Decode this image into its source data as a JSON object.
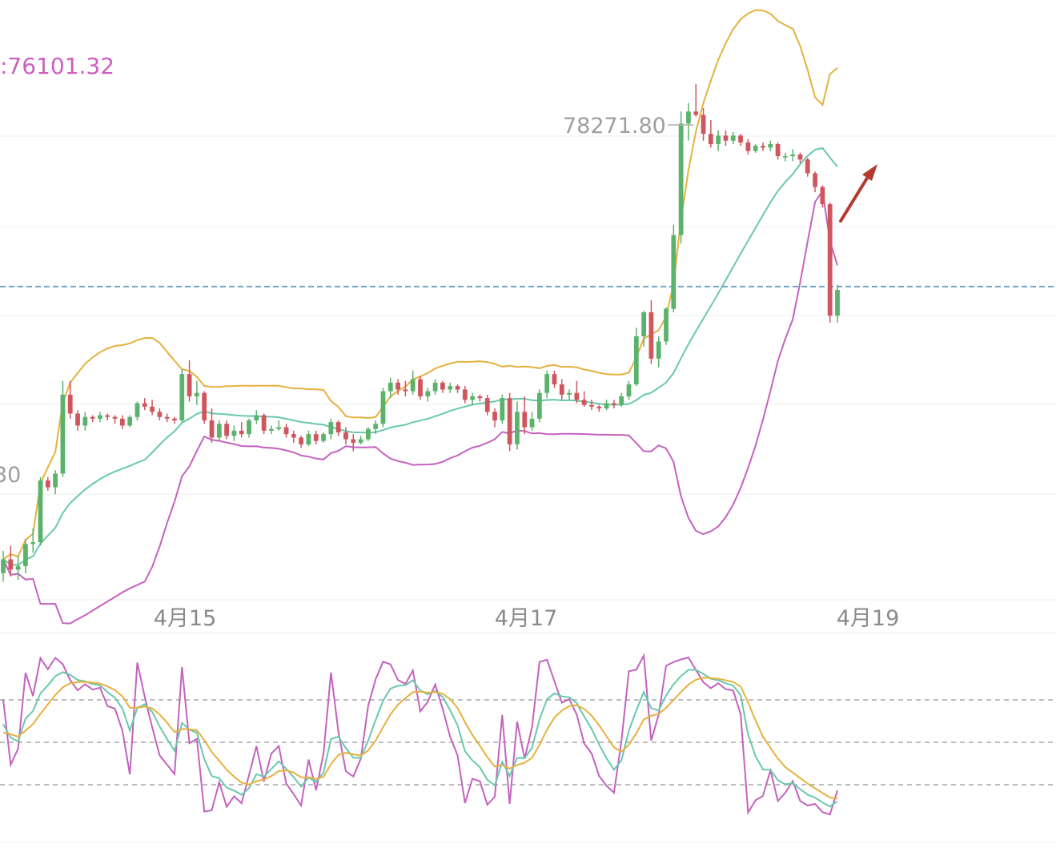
{
  "chart_data": {
    "type": "candlestick",
    "boll_label": ":76101.32",
    "high_marker": "78271.80",
    "low_marker_partial": "30",
    "x_ticks": [
      "4月15",
      "4月17",
      "4月19"
    ],
    "colors": {
      "up": "#5bb26b",
      "down": "#d0565e",
      "boll_upper": "#e6b13e",
      "boll_mid": "#69c8ad",
      "boll_lower": "#c462bf",
      "kdj_k": "#c462bf",
      "kdj_d": "#69c8ad",
      "kdj_j": "#e6b13e",
      "current_price_line": "#6fa5c2",
      "arrow": "#b33a2f",
      "grid": "#eeeeee"
    },
    "candles": [
      [
        75400,
        75530,
        75350,
        75480
      ],
      [
        75480,
        75560,
        75380,
        75420
      ],
      [
        75420,
        75500,
        75360,
        75440
      ],
      [
        75440,
        75600,
        75400,
        75570
      ],
      [
        75570,
        75660,
        75520,
        75580
      ],
      [
        75580,
        75960,
        75560,
        75940
      ],
      [
        75940,
        75960,
        75880,
        75900
      ],
      [
        75900,
        76000,
        75860,
        75980
      ],
      [
        75980,
        76520,
        75960,
        76440
      ],
      [
        76440,
        76520,
        76300,
        76330
      ],
      [
        76330,
        76350,
        76230,
        76260
      ],
      [
        76260,
        76340,
        76230,
        76310
      ],
      [
        76310,
        76320,
        76280,
        76300
      ],
      [
        76300,
        76340,
        76280,
        76320
      ],
      [
        76320,
        76330,
        76290,
        76310
      ],
      [
        76310,
        76320,
        76270,
        76300
      ],
      [
        76300,
        76320,
        76240,
        76260
      ],
      [
        76260,
        76320,
        76250,
        76310
      ],
      [
        76310,
        76400,
        76290,
        76390
      ],
      [
        76390,
        76420,
        76350,
        76370
      ],
      [
        76370,
        76410,
        76320,
        76340
      ],
      [
        76340,
        76360,
        76290,
        76310
      ],
      [
        76310,
        76330,
        76280,
        76300
      ],
      [
        76300,
        76310,
        76270,
        76290
      ],
      [
        76290,
        76590,
        76280,
        76560
      ],
      [
        76560,
        76640,
        76400,
        76430
      ],
      [
        76430,
        76520,
        76380,
        76450
      ],
      [
        76450,
        76460,
        76270,
        76290
      ],
      [
        76290,
        76360,
        76160,
        76190
      ],
      [
        76190,
        76290,
        76170,
        76270
      ],
      [
        76270,
        76290,
        76180,
        76200
      ],
      [
        76200,
        76260,
        76170,
        76230
      ],
      [
        76230,
        76280,
        76190,
        76210
      ],
      [
        76210,
        76300,
        76190,
        76290
      ],
      [
        76290,
        76350,
        76270,
        76320
      ],
      [
        76320,
        76330,
        76210,
        76230
      ],
      [
        76230,
        76260,
        76210,
        76240
      ],
      [
        76240,
        76290,
        76230,
        76250
      ],
      [
        76250,
        76270,
        76190,
        76210
      ],
      [
        76210,
        76230,
        76160,
        76190
      ],
      [
        76190,
        76200,
        76130,
        76150
      ],
      [
        76150,
        76230,
        76140,
        76210
      ],
      [
        76210,
        76230,
        76150,
        76170
      ],
      [
        76170,
        76220,
        76160,
        76210
      ],
      [
        76210,
        76300,
        76180,
        76280
      ],
      [
        76280,
        76290,
        76200,
        76220
      ],
      [
        76220,
        76250,
        76150,
        76180
      ],
      [
        76180,
        76210,
        76110,
        76160
      ],
      [
        76160,
        76200,
        76150,
        76180
      ],
      [
        76180,
        76250,
        76170,
        76240
      ],
      [
        76240,
        76290,
        76210,
        76270
      ],
      [
        76270,
        76480,
        76250,
        76460
      ],
      [
        76460,
        76540,
        76420,
        76510
      ],
      [
        76510,
        76530,
        76440,
        76470
      ],
      [
        76470,
        76520,
        76430,
        76460
      ],
      [
        76460,
        76580,
        76440,
        76530
      ],
      [
        76530,
        76550,
        76410,
        76430
      ],
      [
        76430,
        76480,
        76400,
        76460
      ],
      [
        76460,
        76530,
        76440,
        76510
      ],
      [
        76510,
        76520,
        76450,
        76470
      ],
      [
        76470,
        76510,
        76450,
        76490
      ],
      [
        76490,
        76500,
        76450,
        76470
      ],
      [
        76470,
        76490,
        76390,
        76410
      ],
      [
        76410,
        76450,
        76380,
        76430
      ],
      [
        76430,
        76440,
        76400,
        76420
      ],
      [
        76420,
        76440,
        76320,
        76340
      ],
      [
        76340,
        76360,
        76250,
        76290
      ],
      [
        76290,
        76440,
        76270,
        76420
      ],
      [
        76420,
        76450,
        76110,
        76150
      ],
      [
        76150,
        76400,
        76120,
        76340
      ],
      [
        76340,
        76430,
        76210,
        76250
      ],
      [
        76250,
        76340,
        76230,
        76300
      ],
      [
        76300,
        76470,
        76280,
        76450
      ],
      [
        76450,
        76580,
        76420,
        76560
      ],
      [
        76560,
        76580,
        76480,
        76500
      ],
      [
        76500,
        76530,
        76410,
        76440
      ],
      [
        76440,
        76470,
        76410,
        76450
      ],
      [
        76450,
        76520,
        76390,
        76410
      ],
      [
        76410,
        76460,
        76370,
        76380
      ],
      [
        76380,
        76410,
        76350,
        76370
      ],
      [
        76370,
        76380,
        76340,
        76360
      ],
      [
        76360,
        76410,
        76350,
        76390
      ],
      [
        76390,
        76410,
        76360,
        76380
      ],
      [
        76380,
        76450,
        76370,
        76430
      ],
      [
        76430,
        76520,
        76410,
        76500
      ],
      [
        76500,
        76830,
        76490,
        76780
      ],
      [
        76780,
        76930,
        76720,
        76920
      ],
      [
        76920,
        76990,
        76620,
        76650
      ],
      [
        76650,
        76780,
        76600,
        76750
      ],
      [
        76750,
        76950,
        76730,
        76940
      ],
      [
        76940,
        77430,
        76920,
        77370
      ],
      [
        77370,
        78090,
        77320,
        78020
      ],
      [
        78020,
        78140,
        77920,
        78090
      ],
      [
        78090,
        78250,
        78060,
        78070
      ],
      [
        78070,
        78110,
        77920,
        77960
      ],
      [
        77960,
        78040,
        77880,
        77900
      ],
      [
        77900,
        77980,
        77860,
        77950
      ],
      [
        77950,
        77980,
        77890,
        77920
      ],
      [
        77920,
        77970,
        77900,
        77950
      ],
      [
        77950,
        77960,
        77890,
        77910
      ],
      [
        77910,
        77930,
        77840,
        77860
      ],
      [
        77860,
        77900,
        77850,
        77890
      ],
      [
        77890,
        77910,
        77860,
        77880
      ],
      [
        77880,
        77920,
        77860,
        77900
      ],
      [
        77900,
        77910,
        77810,
        77830
      ],
      [
        77830,
        77850,
        77800,
        77830
      ],
      [
        77830,
        77870,
        77800,
        77840
      ],
      [
        77840,
        77850,
        77790,
        77810
      ],
      [
        77810,
        77820,
        77710,
        77730
      ],
      [
        77730,
        77740,
        77620,
        77650
      ],
      [
        77650,
        77660,
        77530,
        77550
      ],
      [
        77550,
        77560,
        76860,
        76900
      ],
      [
        76900,
        77080,
        76860,
        77050
      ]
    ],
    "y_range": [
      75240,
      78740
    ],
    "current_price_line": 77070
  }
}
